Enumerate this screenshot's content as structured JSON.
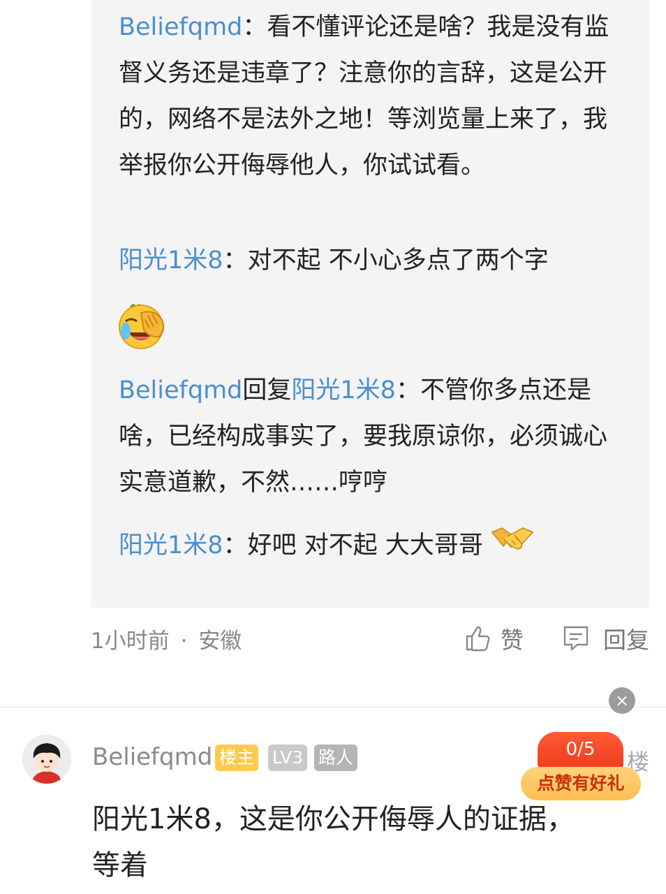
{
  "replies": [
    {
      "user": "Beliefqmd",
      "sep": "：",
      "text": "看不懂评论还是啥？我是没有监督义务还是违章了？注意你的言辞，这是公开的，网络不是法外之地！等浏览量上来了，我举报你公开侮辱他人，你试试看。"
    },
    {
      "user": "阳光1米8",
      "sep": "：",
      "text": "对不起 不小心多点了两个字"
    },
    {
      "user": "Beliefqmd",
      "mid": "回复",
      "target": "阳光1米8",
      "sep": "：",
      "text": "不管你多点还是啥，已经构成事实了，要我原谅你，必须诚心实意道歉，不然……哼哼"
    },
    {
      "user": "阳光1米8",
      "sep": "：",
      "text": "好吧 对不起 大大哥哥"
    }
  ],
  "icons": {
    "reply2_emoji": "facepalm-laugh-emoji-icon",
    "reply4_emoji": "handshake-emoji-icon",
    "like": "thumbs-up-icon",
    "reply": "comment-icon",
    "close": "close-icon"
  },
  "meta": {
    "time": "1小时前",
    "sep": "·",
    "location": "安徽"
  },
  "actions": {
    "like": "赞",
    "reply": "回复"
  },
  "close_symbol": "×",
  "comment": {
    "author": "Beliefqmd",
    "badges": [
      {
        "label": "楼主",
        "color": "#ffc94d"
      },
      {
        "label": "LV3",
        "color": "#c9c9c9"
      },
      {
        "label": "路人",
        "color": "#b5b5b5"
      }
    ],
    "floor_suffix": "楼",
    "text": "阳光1米8，这是你公开侮辱人的证据，等着"
  },
  "promo": {
    "count": "0/5",
    "label": "点赞有好礼"
  }
}
